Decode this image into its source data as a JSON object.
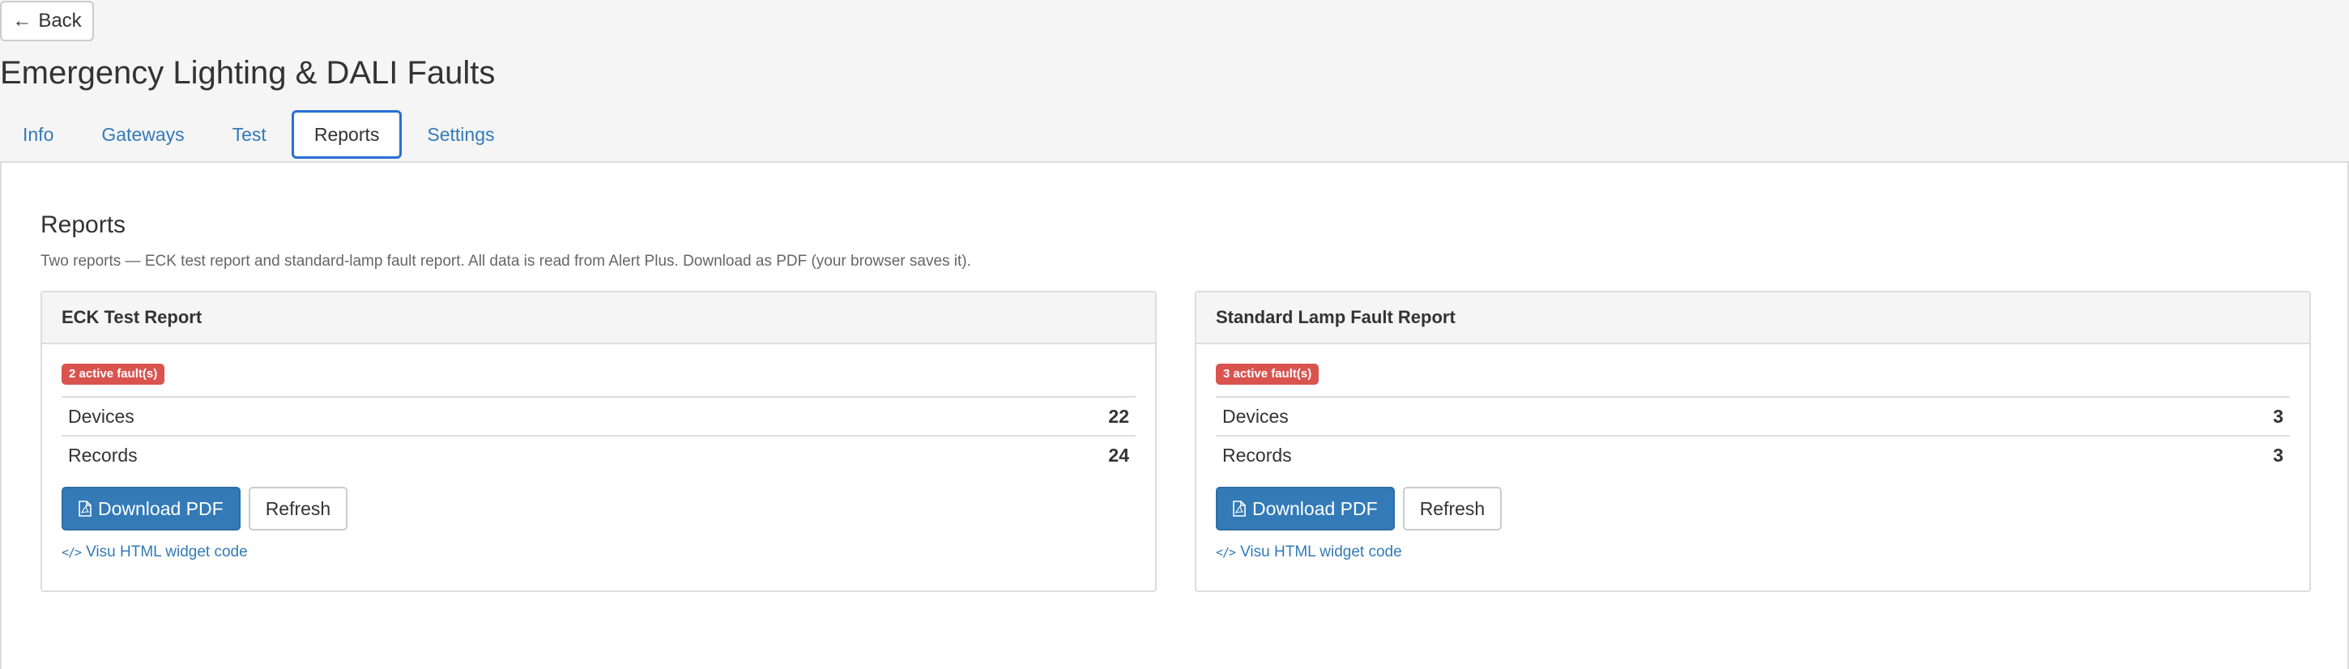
{
  "header": {
    "back_label": "Back",
    "back_arrow": "←",
    "title": "Emergency Lighting & DALI Faults"
  },
  "tabs": [
    {
      "label": "Info",
      "active": false
    },
    {
      "label": "Gateways",
      "active": false
    },
    {
      "label": "Test",
      "active": false
    },
    {
      "label": "Reports",
      "active": true
    },
    {
      "label": "Settings",
      "active": false
    }
  ],
  "reports": {
    "title": "Reports",
    "description": "Two reports — ECK test report and standard-lamp fault report. All data is read from Alert Plus. Download as PDF (your browser saves it).",
    "cards": [
      {
        "title": "ECK Test Report",
        "badge": "2 active fault(s)",
        "rows": [
          {
            "label": "Devices",
            "value": "22"
          },
          {
            "label": "Records",
            "value": "24"
          }
        ],
        "download_label": "Download PDF",
        "refresh_label": "Refresh",
        "widget_icon": "</>",
        "widget_link": "Visu HTML widget code"
      },
      {
        "title": "Standard Lamp Fault Report",
        "badge": "3 active fault(s)",
        "rows": [
          {
            "label": "Devices",
            "value": "3"
          },
          {
            "label": "Records",
            "value": "3"
          }
        ],
        "download_label": "Download PDF",
        "refresh_label": "Refresh",
        "widget_icon": "</>",
        "widget_link": "Visu HTML widget code"
      }
    ]
  },
  "colors": {
    "accent": "#337ab7",
    "danger": "#d9534f",
    "active_tab_border": "#2a6fd6",
    "page_bg": "#f5f5f5"
  },
  "icons": {
    "back": "left-arrow-icon",
    "download": "pdf-file-icon",
    "widget": "code-icon"
  }
}
